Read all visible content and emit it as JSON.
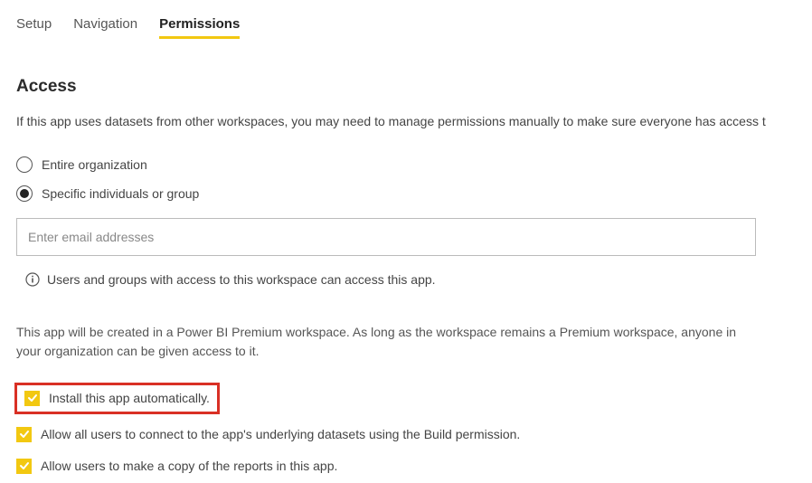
{
  "tabs": {
    "setup": "Setup",
    "navigation": "Navigation",
    "permissions": "Permissions",
    "active": "permissions"
  },
  "access": {
    "heading": "Access",
    "description": "If this app uses datasets from other workspaces, you may need to manage permissions manually to make sure everyone has access t",
    "radio_entire": "Entire organization",
    "radio_specific": "Specific individuals or group",
    "selected_radio": "specific",
    "email_placeholder": "Enter email addresses",
    "info_text": "Users and groups with access to this workspace can access this app.",
    "premium_note": "This app will be created in a Power BI Premium workspace. As long as the workspace remains a Premium workspace, anyone in your organization can be given access to it."
  },
  "checkboxes": {
    "install_auto": "Install this app automatically.",
    "allow_connect": "Allow all users to connect to the app's underlying datasets using the Build permission.",
    "allow_copy": "Allow users to make a copy of the reports in this app."
  },
  "colors": {
    "accent": "#f2c811",
    "highlight_border": "#d93025"
  }
}
